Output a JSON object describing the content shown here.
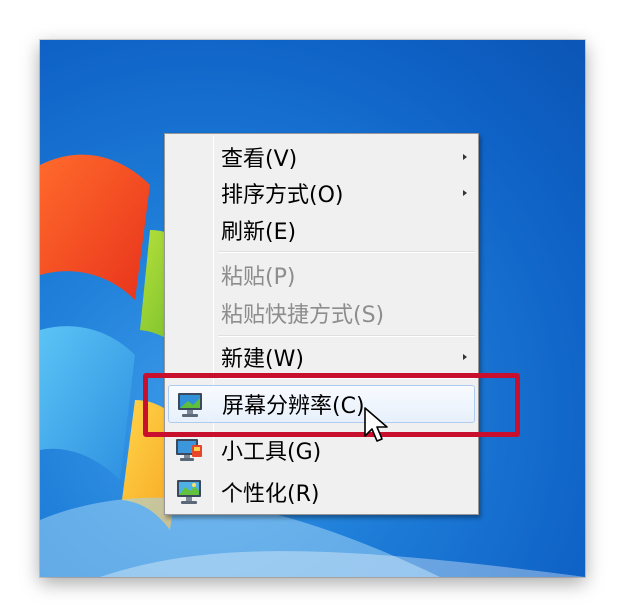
{
  "context_menu": {
    "items": [
      {
        "label": "查看(V)",
        "submenu": true,
        "disabled": false
      },
      {
        "label": "排序方式(O)",
        "submenu": true,
        "disabled": false
      },
      {
        "label": "刷新(E)",
        "submenu": false,
        "disabled": false
      },
      {
        "label": "粘贴(P)",
        "submenu": false,
        "disabled": true
      },
      {
        "label": "粘贴快捷方式(S)",
        "submenu": false,
        "disabled": true
      },
      {
        "label": "新建(W)",
        "submenu": true,
        "disabled": false
      },
      {
        "label": "屏幕分辨率(C)",
        "submenu": false,
        "disabled": false,
        "icon": "monitor-icon",
        "hovered": true
      },
      {
        "label": "小工具(G)",
        "submenu": false,
        "disabled": false,
        "icon": "gadgets-icon"
      },
      {
        "label": "个性化(R)",
        "submenu": false,
        "disabled": false,
        "icon": "personalize-icon"
      }
    ]
  },
  "annotation": {
    "highlight_color": "#c8102e"
  },
  "colors": {
    "desktop_blue": "#1f7fd9",
    "menu_bg": "#f0f0f0",
    "hover_border": "#aeccf0"
  }
}
